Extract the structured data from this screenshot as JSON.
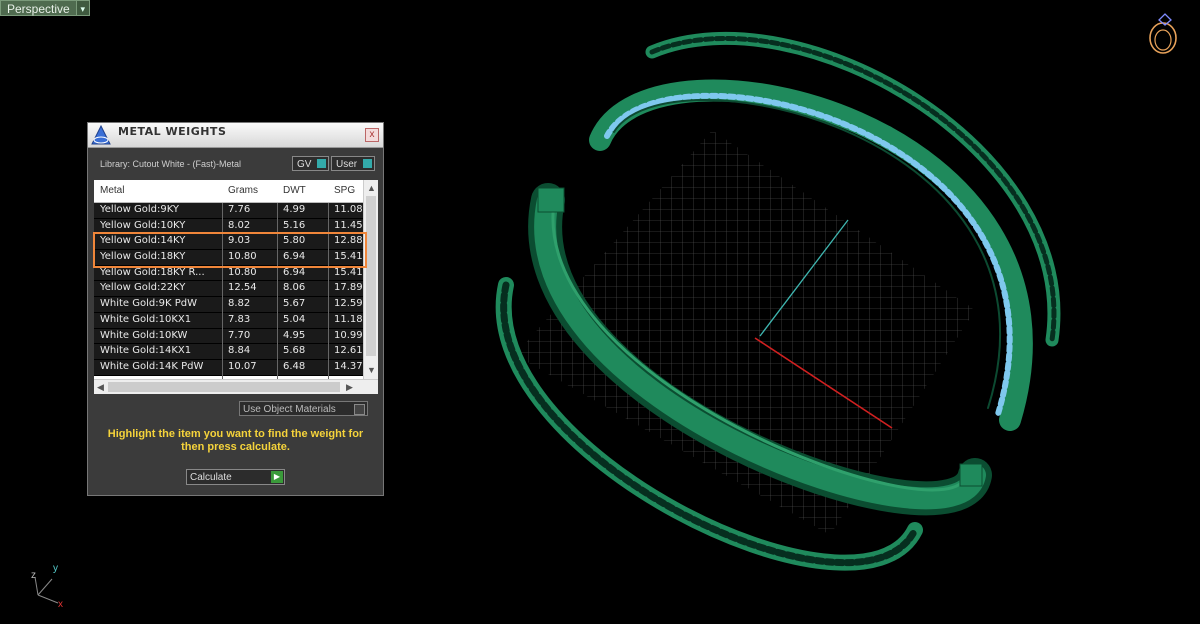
{
  "viewport": {
    "label": "Perspective",
    "dropdown_glyph": "▾"
  },
  "panel": {
    "title": "METAL WEIGHTS",
    "close_glyph": "x",
    "library_label": "Library: Cutout White - (Fast)-Metal",
    "toggle_gv": "GV",
    "toggle_user": "User",
    "columns": [
      "Metal",
      "Grams",
      "DWT",
      "SPG"
    ],
    "rows": [
      [
        "Yellow Gold:9KY",
        "7.76",
        "4.99",
        "11.08"
      ],
      [
        "Yellow Gold:10KY",
        "8.02",
        "5.16",
        "11.45"
      ],
      [
        "Yellow Gold:14KY",
        "9.03",
        "5.80",
        "12.88"
      ],
      [
        "Yellow Gold:18KY",
        "10.80",
        "6.94",
        "15.41"
      ],
      [
        "Yellow Gold:18KY R...",
        "10.80",
        "6.94",
        "15.41"
      ],
      [
        "Yellow Gold:22KY",
        "12.54",
        "8.06",
        "17.89"
      ],
      [
        "White Gold:9K PdW",
        "8.82",
        "5.67",
        "12.59"
      ],
      [
        "White Gold:10KX1",
        "7.83",
        "5.04",
        "11.18"
      ],
      [
        "White Gold:10KW",
        "7.70",
        "4.95",
        "10.99"
      ],
      [
        "White Gold:14KX1",
        "8.84",
        "5.68",
        "12.61"
      ],
      [
        "White Gold:14K PdW",
        "10.07",
        "6.48",
        "14.37"
      ]
    ],
    "use_object_materials": "Use Object Materials",
    "instruction": "Highlight the item you want to find the weight for then press calculate.",
    "calculate_label": "Calculate",
    "calculate_glyph": "▶"
  },
  "axes": {
    "x": "x",
    "y": "y",
    "z": "z"
  },
  "colors": {
    "highlight": "#f0863a",
    "instruction_text": "#f5d33b",
    "model_green": "#1f8a5c",
    "gem_blue": "#7fc8ee"
  }
}
